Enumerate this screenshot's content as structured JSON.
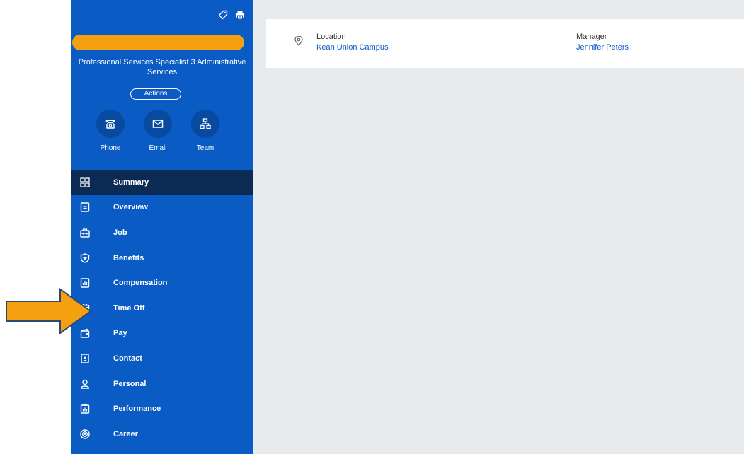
{
  "profile": {
    "job_title": "Professional Services Specialist 3 Administrative Services",
    "actions_label": "Actions",
    "name_bar_color": "#f5a011"
  },
  "contact_actions": [
    {
      "label": "Phone",
      "icon": "phone-icon"
    },
    {
      "label": "Email",
      "icon": "email-icon"
    },
    {
      "label": "Team",
      "icon": "team-icon"
    }
  ],
  "nav": {
    "items": [
      {
        "label": "Summary",
        "icon": "summary-icon",
        "active": true
      },
      {
        "label": "Overview",
        "icon": "overview-icon"
      },
      {
        "label": "Job",
        "icon": "job-icon"
      },
      {
        "label": "Benefits",
        "icon": "benefits-icon"
      },
      {
        "label": "Compensation",
        "icon": "compensation-icon"
      },
      {
        "label": "Time Off",
        "icon": "time-off-icon"
      },
      {
        "label": "Pay",
        "icon": "pay-icon"
      },
      {
        "label": "Contact",
        "icon": "contact-icon"
      },
      {
        "label": "Personal",
        "icon": "personal-icon"
      },
      {
        "label": "Performance",
        "icon": "performance-icon"
      },
      {
        "label": "Career",
        "icon": "career-icon"
      }
    ]
  },
  "details": {
    "location_label": "Location",
    "location_value": "Kean Union Campus",
    "manager_label": "Manager",
    "manager_value": "Jennifer Peters"
  },
  "colors": {
    "sidebar": "#0a5bc4",
    "active_nav": "#0b2a54",
    "link": "#0a5bc4",
    "arrow": "#f5a011",
    "content_bg": "#e8ebed"
  }
}
